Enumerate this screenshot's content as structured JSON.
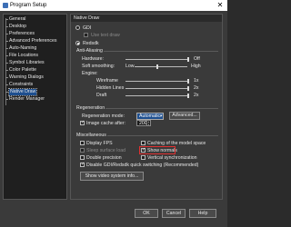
{
  "window": {
    "title": "Program Setup",
    "close_glyph": "✕"
  },
  "nav": {
    "items": [
      "General",
      "Desktop",
      "Preferences",
      "Advanced Preferences",
      "Auto-Naming",
      "File Locations",
      "Symbol Libraries",
      "Color Palette",
      "Warning Dialogs",
      "Constraints",
      "Native Draw",
      "Render Manager"
    ],
    "selected": "Native Draw"
  },
  "panel": {
    "header": "Native Draw",
    "gdi_label": "GDI",
    "gdi_subcheck_label": "Use text draw",
    "redsdk_label": "Redsdk",
    "anti_aliasing": {
      "label": "Anti-Aliasing",
      "hardware_label": "Hardware:",
      "hardware_value": "Off",
      "soft_label": "Soft smoothing:",
      "soft_low": "Low",
      "soft_high": "High",
      "engine_label": "Engine:",
      "wireframe_label": "Wireframe",
      "wireframe_value": "1x",
      "hidden_lines_label": "Hidden Lines",
      "hidden_lines_value": "2x",
      "draft_label": "Draft",
      "draft_value": "2x"
    },
    "regeneration": {
      "label": "Regeneration",
      "mode_label": "Regeneration mode:",
      "mode_value": "Automatic",
      "advanced_button": "Advanced...",
      "cache_label": "Image cache after:",
      "cache_value": "200"
    },
    "miscellaneous": {
      "label": "Miscellaneous",
      "display_fps": "Display FPS",
      "caching_model_space": "Caching of the model space",
      "sleep_surface_load": "Sleep surface load",
      "show_normals": "Show normals",
      "double_precision": "Double precision",
      "vertical_sync": "Vertical synchronization",
      "quick_switching": "Disable GDI/Redsdk quick switching (Recommended)",
      "system_info_button": "Show video system info..."
    }
  },
  "footer": {
    "ok": "OK",
    "cancel": "Cancel",
    "help": "Help"
  },
  "colors": {
    "highlight": "#e03030",
    "selection": "#1e4f8f"
  }
}
